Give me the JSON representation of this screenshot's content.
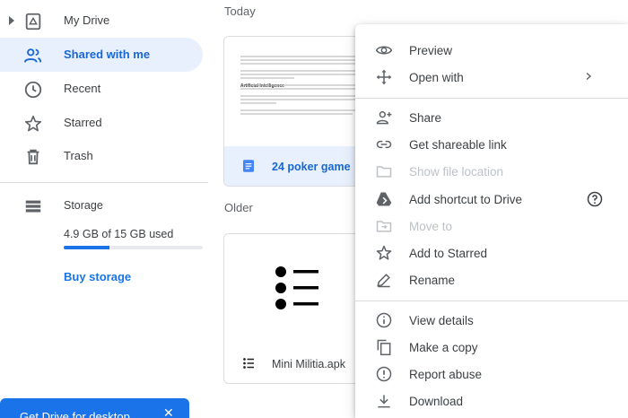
{
  "sidebar": {
    "items": [
      {
        "label": "My Drive"
      },
      {
        "label": "Shared with me"
      },
      {
        "label": "Recent"
      },
      {
        "label": "Starred"
      },
      {
        "label": "Trash"
      }
    ],
    "storage": {
      "label": "Storage",
      "used_text": "4.9 GB of 15 GB used",
      "used_fraction": 0.33,
      "buy_label": "Buy storage"
    },
    "desktop_banner": {
      "label": "Get Drive for desktop",
      "close": "✕"
    }
  },
  "main": {
    "sections": [
      {
        "label": "Today",
        "file": {
          "name": "24 poker game",
          "icon": "google-doc-icon"
        }
      },
      {
        "label": "Older",
        "file": {
          "name": "Mini Militia.apk",
          "icon": "list-icon"
        }
      }
    ],
    "doc_preview": {
      "heading": "Artificial Intelligence"
    }
  },
  "context_menu": {
    "items": [
      {
        "label": "Preview",
        "icon": "eye-icon",
        "enabled": true
      },
      {
        "label": "Open with",
        "icon": "move-arrows-icon",
        "enabled": true,
        "submenu": true
      },
      {
        "label": "Share",
        "icon": "person-add-icon",
        "enabled": true
      },
      {
        "label": "Get shareable link",
        "icon": "link-icon",
        "enabled": true
      },
      {
        "label": "Show file location",
        "icon": "folder-icon",
        "enabled": false
      },
      {
        "label": "Add shortcut to Drive",
        "icon": "drive-shortcut-icon",
        "enabled": true,
        "help": true
      },
      {
        "label": "Move to",
        "icon": "folder-move-icon",
        "enabled": false
      },
      {
        "label": "Add to Starred",
        "icon": "star-icon",
        "enabled": true
      },
      {
        "label": "Rename",
        "icon": "pencil-icon",
        "enabled": true
      },
      {
        "label": "View details",
        "icon": "info-icon",
        "enabled": true
      },
      {
        "label": "Make a copy",
        "icon": "copy-icon",
        "enabled": true
      },
      {
        "label": "Report abuse",
        "icon": "alert-icon",
        "enabled": true
      },
      {
        "label": "Download",
        "icon": "download-icon",
        "enabled": true
      }
    ]
  },
  "colors": {
    "accent": "#1a73e8",
    "active_bg": "#e8f0fe",
    "disabled_text": "#bdc1c6"
  }
}
